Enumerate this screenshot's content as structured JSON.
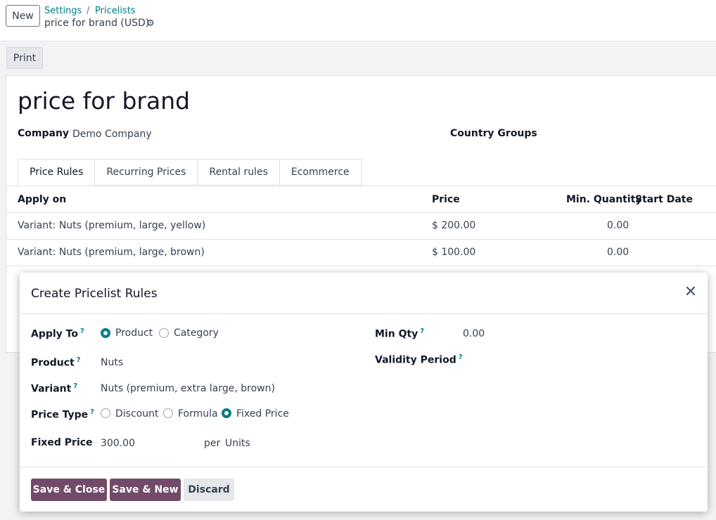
{
  "control_panel": {
    "new_label": "New",
    "breadcrumb": [
      "Settings",
      "/",
      "Pricelists"
    ],
    "record_title": "price for brand (USD)",
    "gear_icon": "gear-icon"
  },
  "form": {
    "print_label": "Print",
    "title": "price for brand",
    "company_label": "Company",
    "company_value": "Demo Company",
    "country_groups_label": "Country Groups",
    "tabs": [
      "Price Rules",
      "Recurring Prices",
      "Rental rules",
      "Ecommerce"
    ],
    "active_tab": "Price Rules",
    "table": {
      "headers": [
        "Apply on",
        "Price",
        "Min. Quantity",
        "Start Date"
      ],
      "rows": [
        {
          "apply_on": "Variant: Nuts (premium, large, yellow)",
          "price": "$ 200.00",
          "min_qty": "0.00"
        },
        {
          "apply_on": "Variant: Nuts (premium, large, brown)",
          "price": "$ 100.00",
          "min_qty": "0.00"
        }
      ]
    }
  },
  "dialog": {
    "title": "Create Pricelist Rules",
    "apply_to_label": "Apply To",
    "apply_to_options": [
      "Product",
      "Category"
    ],
    "apply_to_selected": "Product",
    "product_label": "Product",
    "product_value": "Nuts",
    "variant_label": "Variant",
    "variant_value": "Nuts (premium, extra large, brown)",
    "price_type_label": "Price Type",
    "price_type_options": [
      "Discount",
      "Formula",
      "Fixed Price"
    ],
    "price_type_selected": "Fixed Price",
    "fixed_price_label": "Fixed Price",
    "fixed_price_value": "300.00",
    "per_label": "per",
    "uom_value": "Units",
    "min_qty_label": "Min Qty",
    "min_qty_value": "0.00",
    "validity_label": "Validity Period",
    "help_mark": "?",
    "buttons": {
      "save_close": "Save & Close",
      "save_new": "Save & New",
      "discard": "Discard"
    }
  },
  "colors": {
    "accent_teal": "#017e84",
    "primary_purple": "#714b67"
  }
}
